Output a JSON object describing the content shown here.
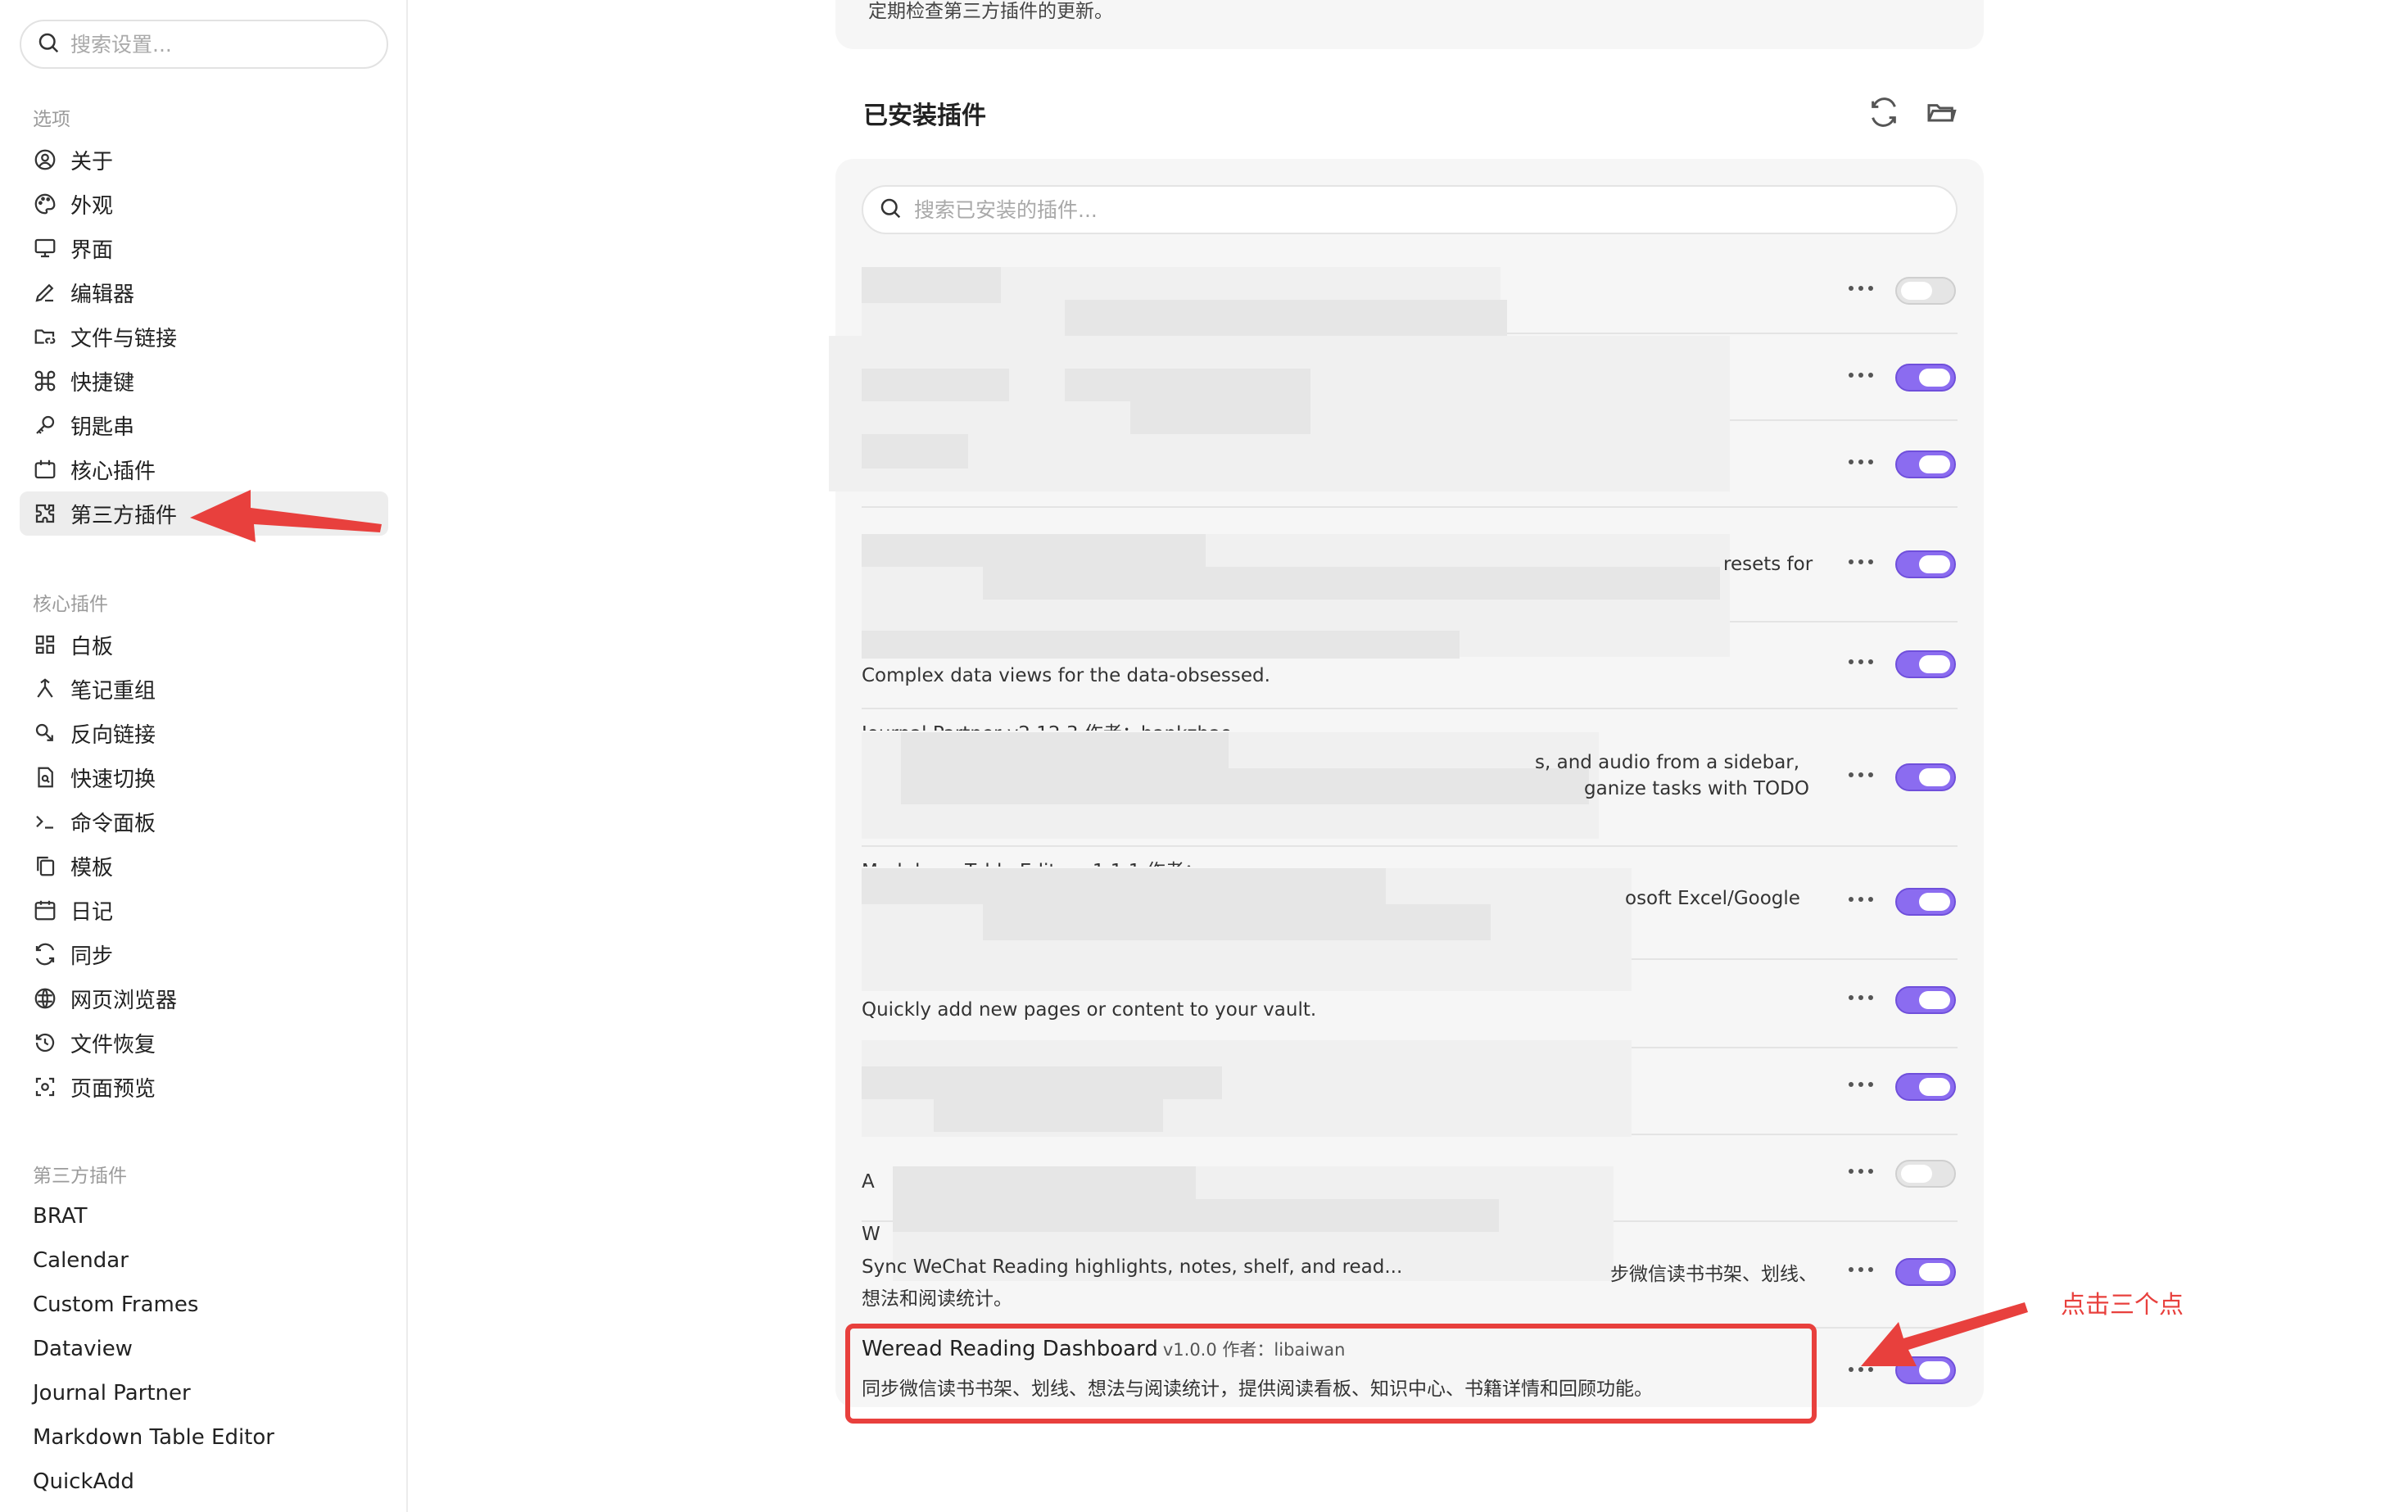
{
  "sidebar": {
    "search_placeholder": "搜索设置...",
    "groups": [
      {
        "title": "选项",
        "items": [
          {
            "label": "关于",
            "icon": "user-circle-icon"
          },
          {
            "label": "外观",
            "icon": "palette-icon"
          },
          {
            "label": "界面",
            "icon": "monitor-icon"
          },
          {
            "label": "编辑器",
            "icon": "pen-icon"
          },
          {
            "label": "文件与链接",
            "icon": "folder-link-icon"
          },
          {
            "label": "快捷键",
            "icon": "command-icon"
          },
          {
            "label": "钥匙串",
            "icon": "key-icon"
          },
          {
            "label": "核心插件",
            "icon": "calendar-box-icon"
          },
          {
            "label": "第三方插件",
            "icon": "puzzle-icon"
          }
        ]
      },
      {
        "title": "核心插件",
        "items": [
          {
            "label": "白板",
            "icon": "grid-icon"
          },
          {
            "label": "笔记重组",
            "icon": "merge-icon"
          },
          {
            "label": "反向链接",
            "icon": "backlink-icon"
          },
          {
            "label": "快速切换",
            "icon": "file-search-icon"
          },
          {
            "label": "命令面板",
            "icon": "terminal-icon"
          },
          {
            "label": "模板",
            "icon": "copy-icon"
          },
          {
            "label": "日记",
            "icon": "calendar-icon"
          },
          {
            "label": "同步",
            "icon": "sync-icon"
          },
          {
            "label": "网页浏览器",
            "icon": "globe-icon"
          },
          {
            "label": "文件恢复",
            "icon": "history-icon"
          },
          {
            "label": "页面预览",
            "icon": "preview-icon"
          }
        ]
      },
      {
        "title": "第三方插件",
        "items": [
          {
            "label": "BRAT"
          },
          {
            "label": "Calendar"
          },
          {
            "label": "Custom Frames"
          },
          {
            "label": "Dataview"
          },
          {
            "label": "Journal Partner"
          },
          {
            "label": "Markdown Table Editor"
          },
          {
            "label": "QuickAdd"
          }
        ]
      }
    ]
  },
  "main": {
    "top_card_text": "定期检查第三方插件的更新。",
    "section_title": "已安装插件",
    "search_placeholder": "搜索已安装的插件...",
    "visible_fragments": {
      "row4": "resets for",
      "row5": "Complex data views for the data-obsessed.",
      "row6_a": "Journal Partner v2.12.3 作者：hankzhao",
      "row6_b": "s, and audio from a sidebar,",
      "row6_c": "ganize tasks with TODO",
      "row7_a": "Markdown Table Editor v1.1.1 作者：...",
      "row7_b": "osoft Excel/Google",
      "row8": "Quickly add new pages or content to your vault.",
      "row10": "A",
      "row11_a": "W",
      "row11_b": "Sync WeChat Reading highlights, notes, shelf, and read...",
      "row11_c": "步微信读书书架、划线、",
      "row11_d": "想法和阅读统计。"
    },
    "weread": {
      "name": "Weread Reading Dashboard",
      "version": "v1.0.0 作者：libaiwan",
      "description": "同步微信读书书架、划线、想法与阅读统计，提供阅读看板、知识中心、书籍详情和回顾功能。"
    },
    "toggles": [
      "off",
      "on",
      "on",
      "on",
      "on",
      "on",
      "on",
      "on",
      "on",
      "off",
      "on",
      "on"
    ]
  },
  "annotation": {
    "text": "点击三个点",
    "color": "#e8403d"
  },
  "colors": {
    "toggle_on": "#8b6cf0",
    "toggle_off": "#e5e5e5"
  }
}
